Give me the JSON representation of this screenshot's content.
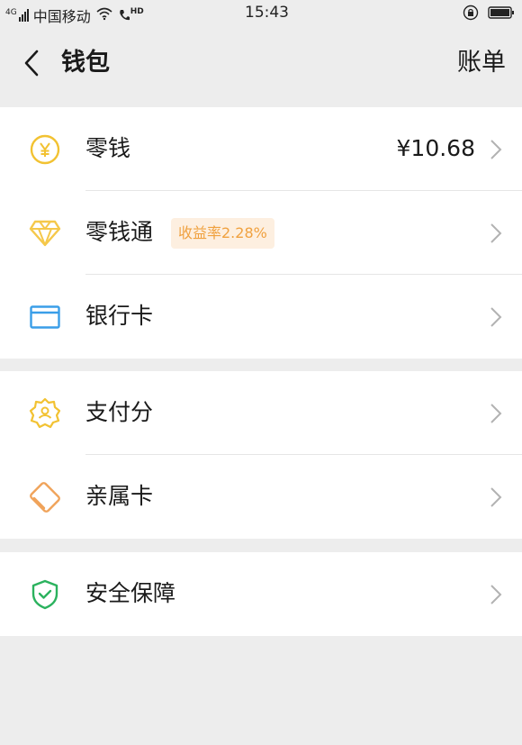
{
  "status_bar": {
    "carrier": "中国移动",
    "network_tag": "4G",
    "hd_tag": "HD",
    "time": "15:43",
    "icons": [
      "signal-icon",
      "wifi-icon",
      "hd-call-icon",
      "lock-icon",
      "battery-icon"
    ]
  },
  "nav": {
    "back_icon": "chevron-left-icon",
    "title": "钱包",
    "bill_label": "账单"
  },
  "colors": {
    "background": "#ededed",
    "card": "#ffffff",
    "change_icon": "#f2c232",
    "licaitong_icon": "#f5c84a",
    "bank_card_icon": "#3a9ee8",
    "credit_score_icon": "#f2c232",
    "family_card_icon": "#f0a35a",
    "security_icon": "#2bb25e",
    "tag_bg": "#fdefe0",
    "tag_text": "#f0a13f"
  },
  "groups": [
    {
      "items": [
        {
          "id": "change",
          "icon": "yuan-coin-icon",
          "label": "零钱",
          "value": "¥10.68",
          "tag": ""
        },
        {
          "id": "licaitong",
          "icon": "diamond-icon",
          "label": "零钱通",
          "value": "",
          "tag": "收益率2.28%"
        },
        {
          "id": "bank-card",
          "icon": "bank-card-icon",
          "label": "银行卡",
          "value": "",
          "tag": ""
        }
      ]
    },
    {
      "items": [
        {
          "id": "credit-score",
          "icon": "credit-badge-icon",
          "label": "支付分",
          "value": "",
          "tag": ""
        },
        {
          "id": "family-card",
          "icon": "family-card-icon",
          "label": "亲属卡",
          "value": "",
          "tag": ""
        }
      ]
    },
    {
      "items": [
        {
          "id": "security",
          "icon": "shield-check-icon",
          "label": "安全保障",
          "value": "",
          "tag": ""
        }
      ]
    }
  ]
}
